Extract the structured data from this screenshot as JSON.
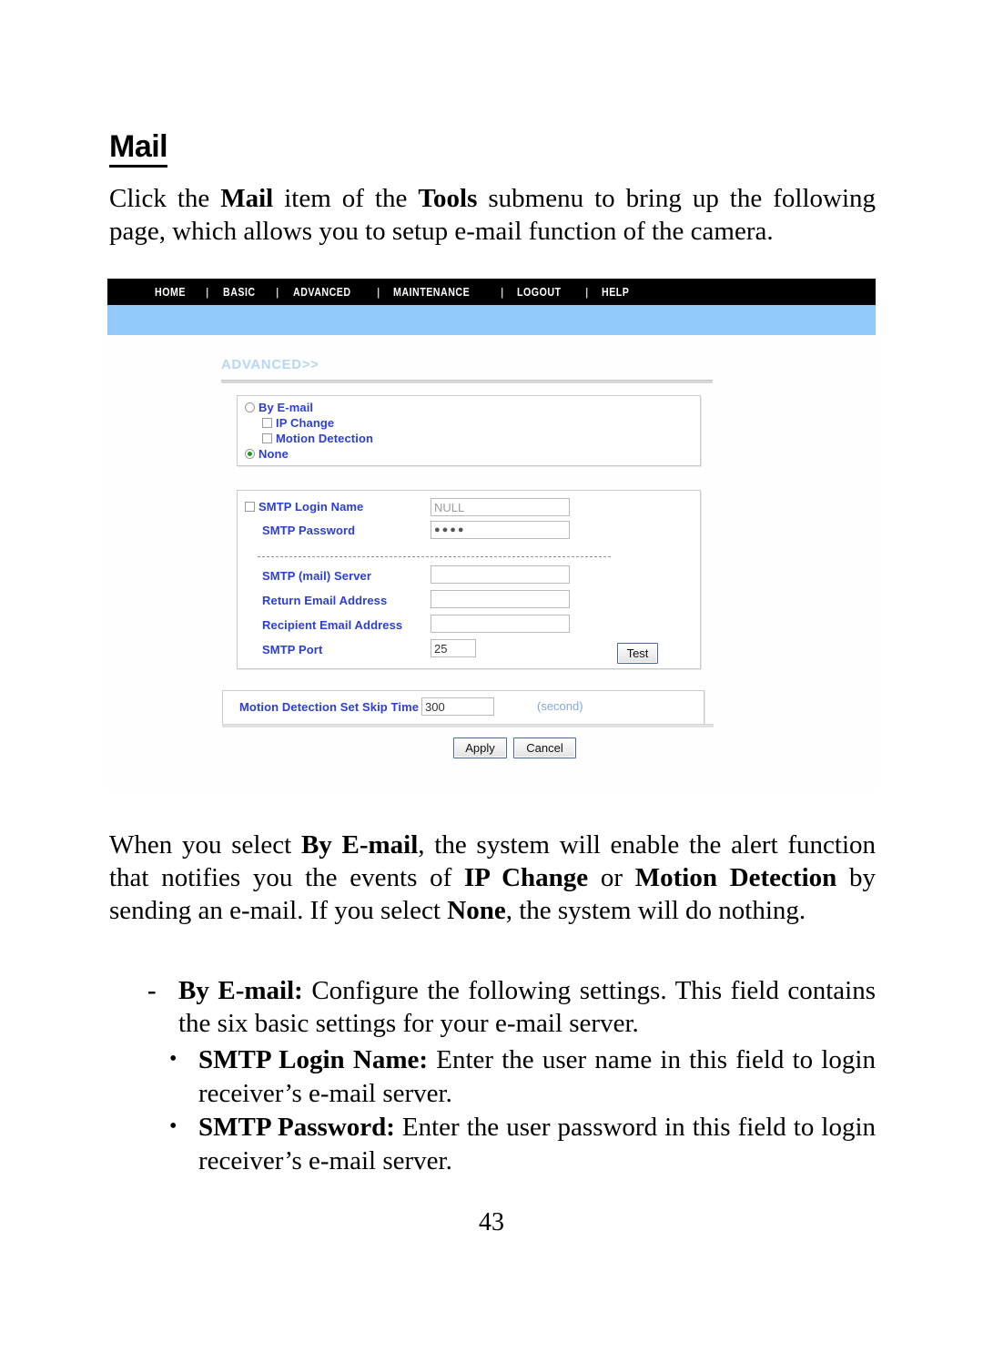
{
  "document": {
    "heading": "Mail",
    "intro_paragraph": {
      "parts": [
        {
          "text": "Click the ",
          "bold": false
        },
        {
          "text": "Mail",
          "bold": true
        },
        {
          "text": " item of the ",
          "bold": false
        },
        {
          "text": "Tools",
          "bold": true
        },
        {
          "text": " submenu to bring up the following page, which allows you to setup e-mail function of the camera.",
          "bold": false
        }
      ]
    },
    "explain_paragraph": {
      "parts": [
        {
          "text": "When you select ",
          "bold": false
        },
        {
          "text": "By E-mail",
          "bold": true
        },
        {
          "text": ", the system will enable the alert function that notifies you the events of ",
          "bold": false
        },
        {
          "text": "IP Change",
          "bold": true
        },
        {
          "text": " or ",
          "bold": false
        },
        {
          "text": "Motion Detection",
          "bold": true
        },
        {
          "text": " by sending an e-mail.  If you select ",
          "bold": false
        },
        {
          "text": "None",
          "bold": true
        },
        {
          "text": ", the system will do nothing.",
          "bold": false
        }
      ]
    },
    "dash_item": {
      "marker": "-",
      "parts": [
        {
          "text": "By E-mail:",
          "bold": true
        },
        {
          "text": " Configure the following settings.  This field contains the six basic settings for your e-mail server.",
          "bold": false
        }
      ]
    },
    "bullets": [
      {
        "marker": "•",
        "parts": [
          {
            "text": "SMTP Login Name:",
            "bold": true
          },
          {
            "text": " Enter the user name in this field to login receiver’s e-mail server.",
            "bold": false
          }
        ]
      },
      {
        "marker": "•",
        "parts": [
          {
            "text": "SMTP Password:",
            "bold": true
          },
          {
            "text": " Enter the user password in this field to login receiver’s e-mail server.",
            "bold": false
          }
        ]
      }
    ],
    "page_number": "43"
  },
  "screenshot": {
    "navbar": {
      "items": [
        "HOME",
        "BASIC",
        "ADVANCED",
        "MAINTENANCE",
        "LOGOUT",
        "HELP"
      ],
      "separator": "|",
      "background": "#000000",
      "text_color": "#ffffff"
    },
    "band_color": "#93c8fa",
    "breadcrumb": "ADVANCED>>",
    "breadcrumb_color": "#b5d7f5",
    "alert_panel": {
      "options": [
        {
          "type": "radio",
          "label": "By E-mail",
          "checked": false,
          "indent": 0
        },
        {
          "type": "checkbox",
          "label": "IP Change",
          "checked": false,
          "indent": 1
        },
        {
          "type": "checkbox",
          "label": "Motion Detection",
          "checked": false,
          "indent": 1
        },
        {
          "type": "radio",
          "label": "None",
          "checked": true,
          "indent": 0
        }
      ]
    },
    "smtp_panel": {
      "login_name": {
        "label": "SMTP Login Name",
        "checkbox_checked": false,
        "value": "NULL",
        "value_is_placeholder": true
      },
      "password": {
        "label": "SMTP Password",
        "value": "●●●●"
      },
      "fields": [
        {
          "label": "SMTP (mail) Server",
          "value": ""
        },
        {
          "label": "Return Email Address",
          "value": ""
        },
        {
          "label": "Recipient Email Address",
          "value": ""
        }
      ],
      "port": {
        "label": "SMTP Port",
        "value": "25"
      },
      "test_button": "Test"
    },
    "skip_panel": {
      "label": "Motion Detection Set Skip Time",
      "value": "300",
      "unit": "(second)"
    },
    "actions": {
      "apply": "Apply",
      "cancel": "Cancel"
    },
    "colors": {
      "label_blue": "#2b3ed6",
      "unit_blue": "#7fa9dd",
      "radio_checked_green": "#179c17",
      "panel_border": "#c9c9c9"
    }
  }
}
